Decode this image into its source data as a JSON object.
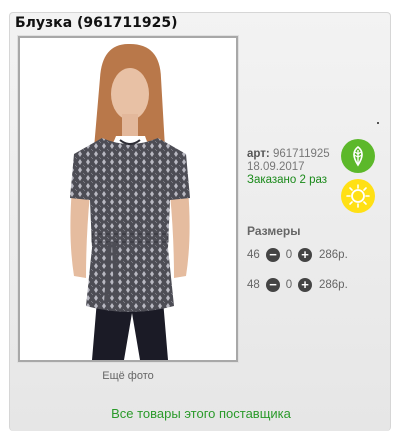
{
  "product": {
    "title": "Блузка (961711925)",
    "art_label": "арт:",
    "art_value": "961711925",
    "date": "18.09.2017",
    "ordered": "Заказано 2 раз"
  },
  "photo": {
    "more_label": "Ещё фото"
  },
  "sizes": {
    "title": "Размеры",
    "rows": [
      {
        "size": "46",
        "minus": "−",
        "qty": "0",
        "plus": "+",
        "price": "286р."
      },
      {
        "size": "48",
        "minus": "−",
        "qty": "0",
        "plus": "+",
        "price": "286р."
      }
    ]
  },
  "footer": {
    "all_goods_link": "Все товары этого поставщика"
  },
  "icons": {
    "eco": "leaf-icon",
    "sun": "sun-icon"
  },
  "colors": {
    "accent_green": "#5cb82a",
    "sun_yellow": "#ffe014",
    "link_green": "#2a9a2a"
  }
}
